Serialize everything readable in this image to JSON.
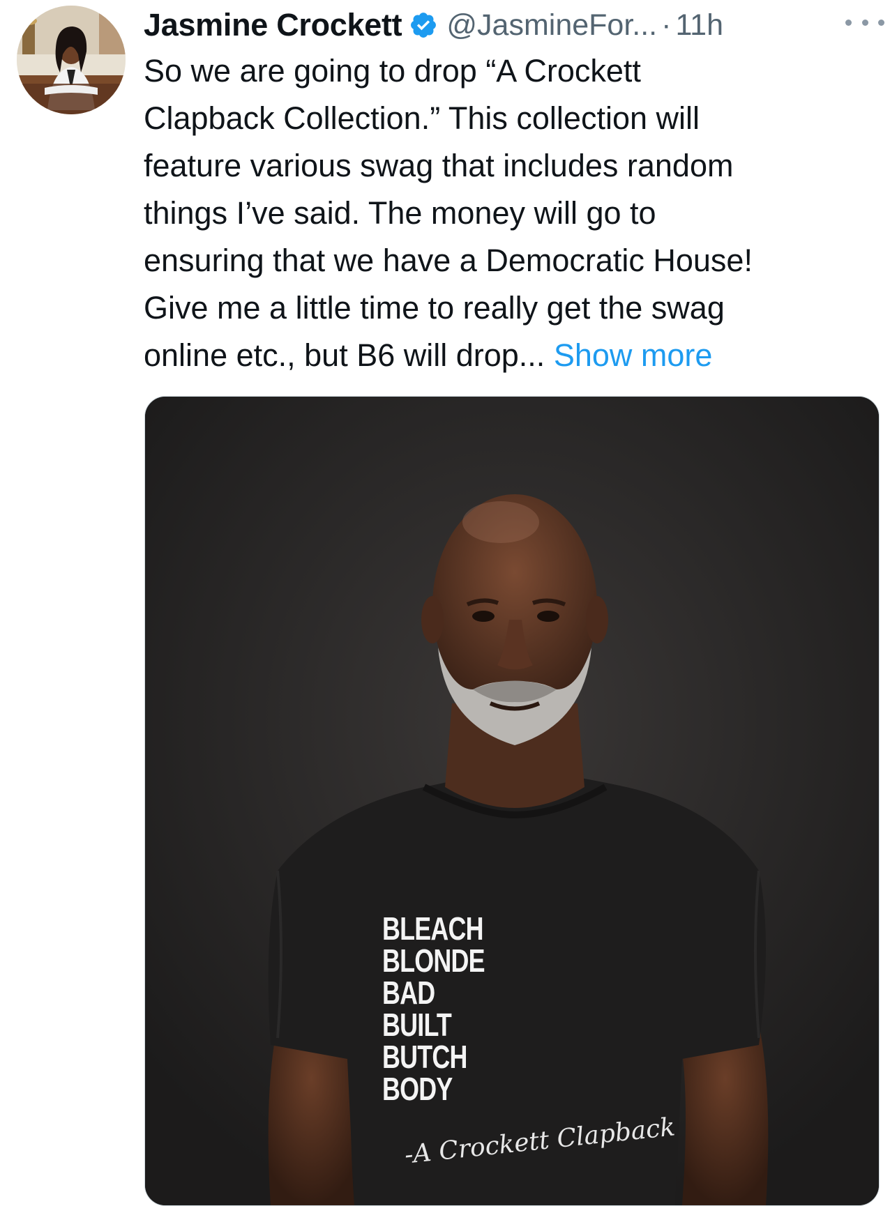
{
  "tweet": {
    "author": {
      "display_name": "Jasmine Crockett",
      "handle": "@JasmineFor...",
      "verified": true,
      "avatar_icon": "profile-photo"
    },
    "separator": "·",
    "time": "11h",
    "text": "So we are going to drop “A Crockett\nClapback Collection.” This collection will\nfeature various swag that includes random\nthings I’ve said. The money will go to\nensuring that we have a Democratic House!\nGive me a little time to really get the swag\nonline etc., but B6 will drop... ",
    "show_more_label": "Show more",
    "colors": {
      "link": "#1d9bf0",
      "verified": "#1d9bf0",
      "secondary_text": "#536471"
    },
    "media": {
      "shirt_lines": [
        "BLEACH",
        "BLONDE",
        "BAD",
        "BUILT",
        "BUTCH",
        "BODY"
      ],
      "signature": "-A Crockett Clapback"
    }
  }
}
